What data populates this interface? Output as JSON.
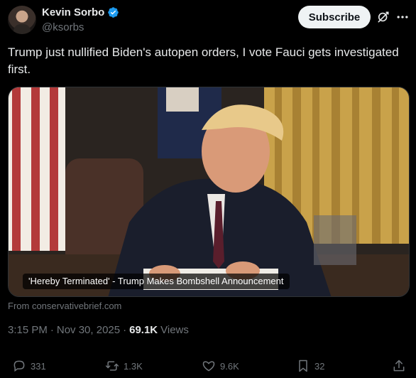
{
  "author": {
    "display_name": "Kevin Sorbo",
    "handle": "@ksorbs",
    "verified_color": "#1d9bf0"
  },
  "header": {
    "subscribe_label": "Subscribe",
    "grok_icon": "grok-icon",
    "more_icon": "more-horizontal-icon"
  },
  "tweet": {
    "text": "Trump just nullified Biden's autopen orders, I vote Fauci gets investigated first."
  },
  "media": {
    "caption": "'Hereby Terminated' - Trump Makes Bombshell Announcement",
    "source": "From conservativebrief.com"
  },
  "meta": {
    "time": "3:15 PM",
    "separator": "·",
    "date": "Nov 30, 2025",
    "separator2": "·",
    "views_count": "69.1K",
    "views_label": "Views"
  },
  "actions": {
    "replies": "331",
    "reposts": "1.3K",
    "likes": "9.6K",
    "bookmarks": "32"
  },
  "colors": {
    "background": "#000000",
    "text_primary": "#e7e9ea",
    "text_secondary": "#71767b",
    "button_bg": "#eff3f4"
  }
}
